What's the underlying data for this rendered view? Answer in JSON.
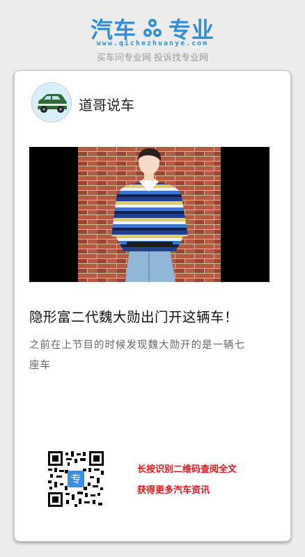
{
  "brand": {
    "logo_left": "汽车",
    "logo_right": "专业",
    "url": "www.qichezhuanye.com",
    "tagline": "买车问专业网 投诉找专业网",
    "color": "#2f8fd9"
  },
  "author": {
    "name": "道哥说车",
    "avatar_icon": "green-car-icon"
  },
  "article": {
    "title": "隐形富二代魏大勋出门开这辆车！",
    "summary": "之前在上节目的时候发现魏大勋开的是一辆七座车"
  },
  "qr_prompt": {
    "line1": "长按识别二维码查阅全文",
    "line2": "获得更多汽车资讯",
    "color": "#e8131b",
    "center_label": "专"
  }
}
